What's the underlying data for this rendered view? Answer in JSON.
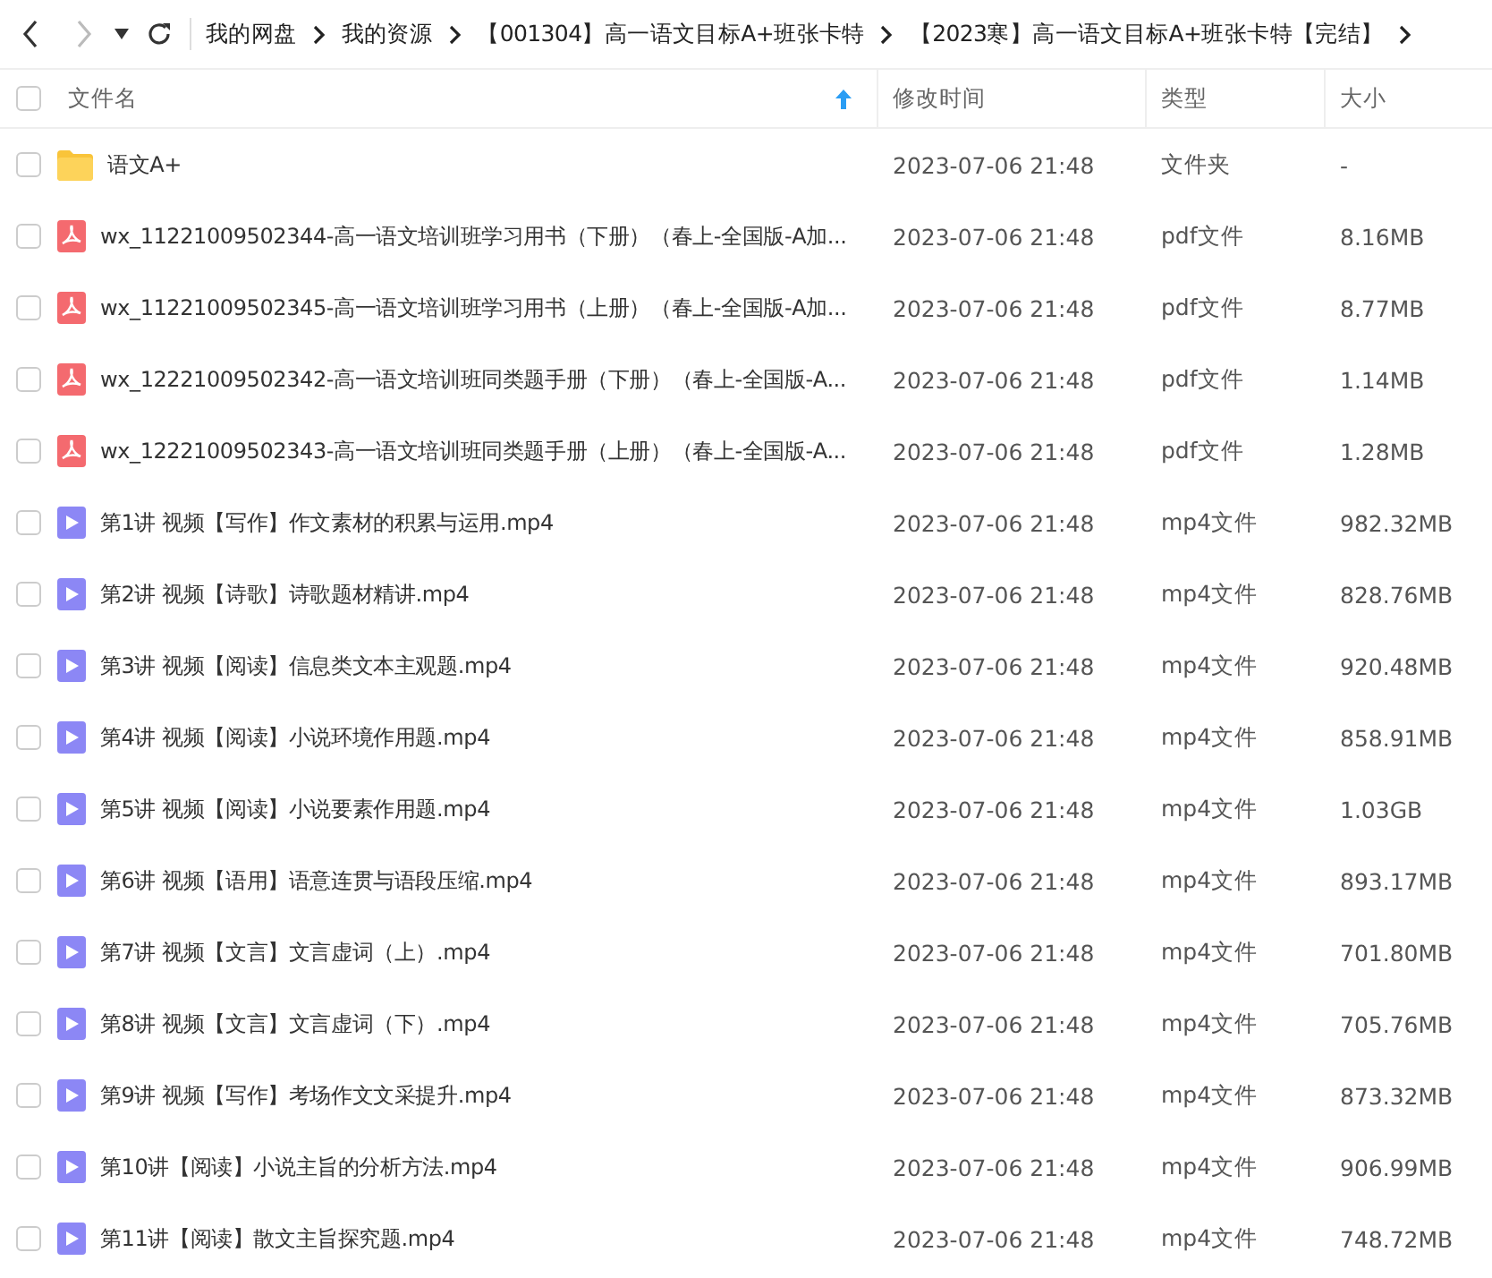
{
  "breadcrumb": [
    "我的网盘",
    "我的资源",
    "【001304】高一语文目标A+班张卡特",
    "【2023寒】高一语文目标A+班张卡特【完结】"
  ],
  "table": {
    "select_all": {
      "checked": false
    },
    "columns": [
      {
        "label": "文件名",
        "sorted": true
      },
      {
        "label": "修改时间",
        "sorted": false
      },
      {
        "label": "类型",
        "sorted": false
      },
      {
        "label": "大小",
        "sorted": false
      }
    ],
    "rows": [
      {
        "kind": "folder",
        "name": "语文A+",
        "time": "2023-07-06 21:48",
        "type": "文件夹",
        "size": "-",
        "checked": false
      },
      {
        "kind": "pdf",
        "name": "wx_11221009502344-高一语文培训班学习用书（下册）（春上-全国版-A加...",
        "time": "2023-07-06 21:48",
        "type": "pdf文件",
        "size": "8.16MB",
        "checked": false
      },
      {
        "kind": "pdf",
        "name": "wx_11221009502345-高一语文培训班学习用书（上册）（春上-全国版-A加...",
        "time": "2023-07-06 21:48",
        "type": "pdf文件",
        "size": "8.77MB",
        "checked": false
      },
      {
        "kind": "pdf",
        "name": "wx_12221009502342-高一语文培训班同类题手册（下册）（春上-全国版-A...",
        "time": "2023-07-06 21:48",
        "type": "pdf文件",
        "size": "1.14MB",
        "checked": false
      },
      {
        "kind": "pdf",
        "name": "wx_12221009502343-高一语文培训班同类题手册（上册）（春上-全国版-A...",
        "time": "2023-07-06 21:48",
        "type": "pdf文件",
        "size": "1.28MB",
        "checked": false
      },
      {
        "kind": "video",
        "name": "第1讲 视频【写作】作文素材的积累与运用.mp4",
        "time": "2023-07-06 21:48",
        "type": "mp4文件",
        "size": "982.32MB",
        "checked": false
      },
      {
        "kind": "video",
        "name": "第2讲 视频【诗歌】诗歌题材精讲.mp4",
        "time": "2023-07-06 21:48",
        "type": "mp4文件",
        "size": "828.76MB",
        "checked": false
      },
      {
        "kind": "video",
        "name": "第3讲 视频【阅读】信息类文本主观题.mp4",
        "time": "2023-07-06 21:48",
        "type": "mp4文件",
        "size": "920.48MB",
        "checked": false
      },
      {
        "kind": "video",
        "name": "第4讲 视频【阅读】小说环境作用题.mp4",
        "time": "2023-07-06 21:48",
        "type": "mp4文件",
        "size": "858.91MB",
        "checked": false
      },
      {
        "kind": "video",
        "name": "第5讲 视频【阅读】小说要素作用题.mp4",
        "time": "2023-07-06 21:48",
        "type": "mp4文件",
        "size": "1.03GB",
        "checked": false
      },
      {
        "kind": "video",
        "name": "第6讲 视频【语用】语意连贯与语段压缩.mp4",
        "time": "2023-07-06 21:48",
        "type": "mp4文件",
        "size": "893.17MB",
        "checked": false
      },
      {
        "kind": "video",
        "name": "第7讲 视频【文言】文言虚词（上）.mp4",
        "time": "2023-07-06 21:48",
        "type": "mp4文件",
        "size": "701.80MB",
        "checked": false
      },
      {
        "kind": "video",
        "name": "第8讲 视频【文言】文言虚词（下）.mp4",
        "time": "2023-07-06 21:48",
        "type": "mp4文件",
        "size": "705.76MB",
        "checked": false
      },
      {
        "kind": "video",
        "name": "第9讲 视频【写作】考场作文文采提升.mp4",
        "time": "2023-07-06 21:48",
        "type": "mp4文件",
        "size": "873.32MB",
        "checked": false
      },
      {
        "kind": "video",
        "name": "第10讲【阅读】小说主旨的分析方法.mp4",
        "time": "2023-07-06 21:48",
        "type": "mp4文件",
        "size": "906.99MB",
        "checked": false
      },
      {
        "kind": "video",
        "name": "第11讲【阅读】散文主旨探究题.mp4",
        "time": "2023-07-06 21:48",
        "type": "mp4文件",
        "size": "748.72MB",
        "checked": false
      }
    ]
  }
}
